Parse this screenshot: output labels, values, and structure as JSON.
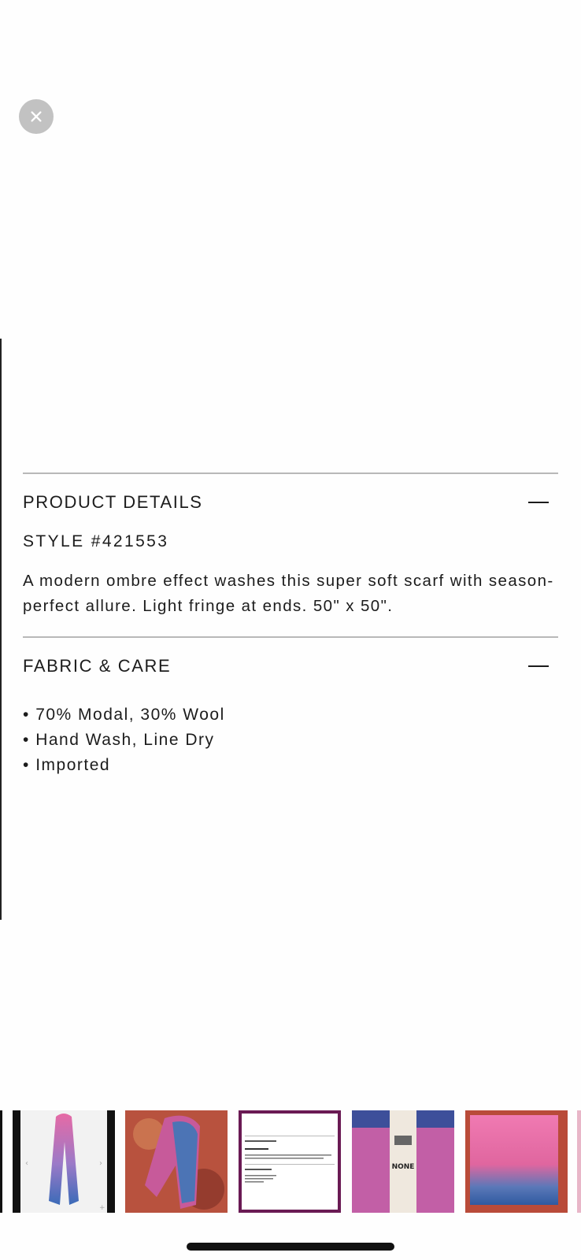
{
  "close_label": "Close",
  "product_details": {
    "heading": "PRODUCT DETAILS",
    "style": "STYLE #421553",
    "description": "A modern ombre effect washes this super soft scarf with season-perfect allure. Light fringe at ends. 50\" x 50\"."
  },
  "fabric_care": {
    "heading": "FABRIC & CARE",
    "items": [
      "70% Modal, 30% Wool",
      "Hand Wash, Line Dry",
      "Imported"
    ]
  },
  "thumbnails": [
    {
      "name": "Scarf on white background",
      "selected": false
    },
    {
      "name": "Scarf on rug",
      "selected": false
    },
    {
      "name": "Product details screenshot",
      "selected": true
    },
    {
      "name": "Price tag",
      "selected": false
    },
    {
      "name": "Folded scarf",
      "selected": false
    }
  ],
  "tag_text": "NONE",
  "colors": {
    "accent_selected_border": "#6a1a54",
    "divider": "#b8b8b8",
    "close_button_bg": "#c2c2c2"
  }
}
